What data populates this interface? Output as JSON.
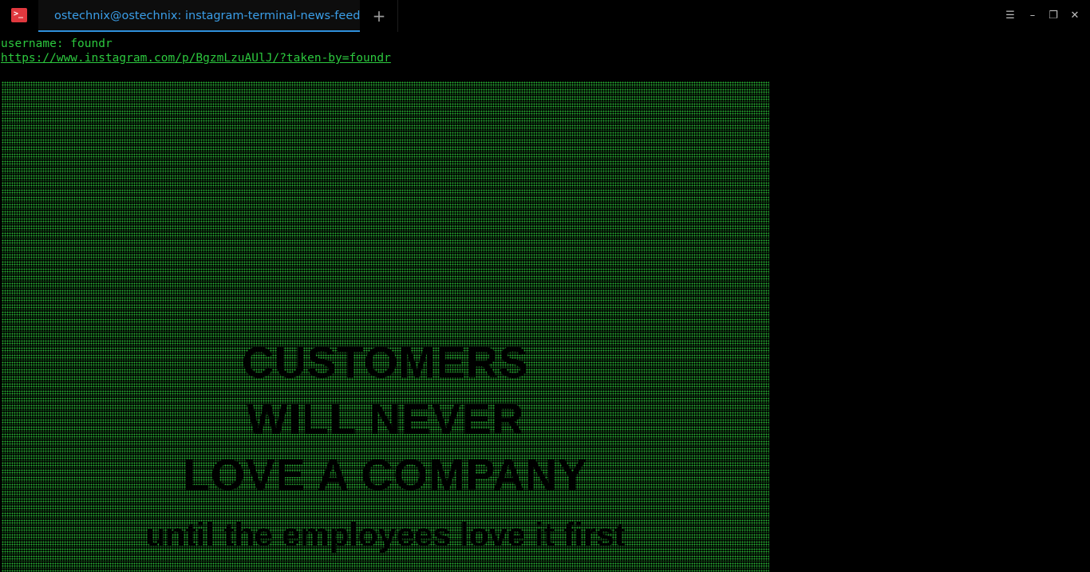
{
  "window": {
    "tab_title": "ostechnix@ostechnix: instagram-terminal-news-feed",
    "new_tab_glyph": "+",
    "menu_glyph": "☰",
    "minimize_glyph": "–",
    "restore_glyph": "❐",
    "close_glyph": "✕",
    "app_icon_glyph": ">_"
  },
  "terminal": {
    "username_line": "username: foundr",
    "url_line": "https://www.instagram.com/p/BgzmLzuAUlJ/?taken-by=foundr"
  },
  "poster": {
    "line1": "CUSTOMERS",
    "line2": "WILL NEVER",
    "line3": "LOVE A COMPANY",
    "line4": "until the employees love it first"
  },
  "colors": {
    "terminal_green": "#2cc83e",
    "tab_accent": "#3a9ee8",
    "app_icon": "#e0383e",
    "background": "#000000"
  }
}
